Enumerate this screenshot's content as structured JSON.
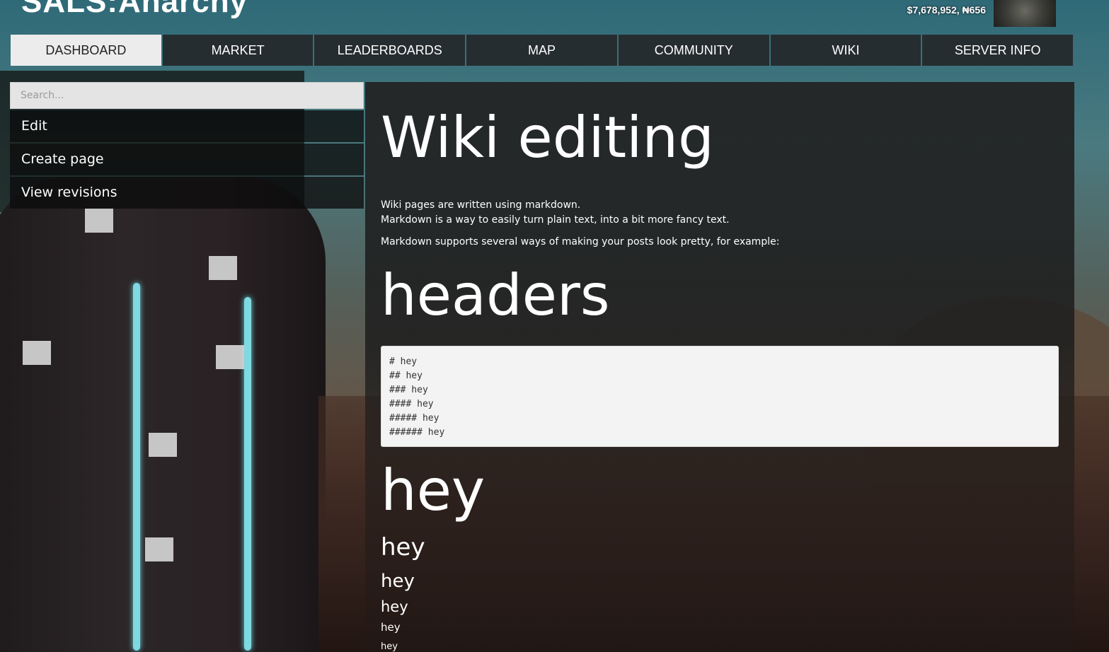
{
  "header": {
    "site_title": "SALS:Anarchy",
    "balance": "$7,678,952, ₦656"
  },
  "nav": {
    "tabs": [
      {
        "label": "DASHBOARD",
        "active": true
      },
      {
        "label": "MARKET"
      },
      {
        "label": "LEADERBOARDS"
      },
      {
        "label": "MAP"
      },
      {
        "label": "COMMUNITY"
      },
      {
        "label": "WIKI"
      },
      {
        "label": "SERVER INFO"
      }
    ]
  },
  "sidebar": {
    "search_placeholder": "Search...",
    "items": [
      {
        "label": "Edit"
      },
      {
        "label": "Create page"
      },
      {
        "label": "View revisions"
      }
    ]
  },
  "main": {
    "title": "Wiki editing",
    "intro_line1": "Wiki pages are written using markdown.",
    "intro_line2": "Markdown is a way to easily turn plain text, into a bit more fancy text.",
    "intro_line3": "Markdown supports several ways of making your posts look pretty, for example:",
    "section_heading": "headers",
    "code_lines": [
      "# hey",
      "## hey",
      "### hey",
      "#### hey",
      "##### hey",
      "###### hey"
    ],
    "examples": {
      "h1": "hey",
      "h2": "hey",
      "h3": "hey",
      "h4": "hey",
      "h5": "hey",
      "h6": "hey"
    }
  },
  "colors": {
    "nav_bg": "#262d30",
    "nav_active_bg": "#ececec",
    "panel_bg": "#222424",
    "code_bg": "#f3f3f3"
  }
}
